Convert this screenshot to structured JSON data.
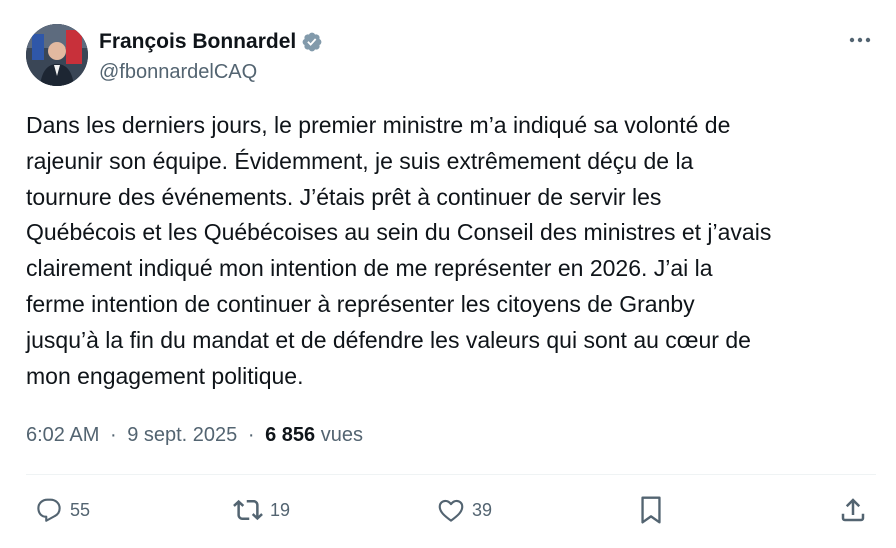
{
  "author": {
    "name": "François Bonnardel",
    "handle": "@fbonnardelCAQ",
    "verified_icon": "verified-badge-icon",
    "accent_color": "#1d9bf0"
  },
  "tweet": {
    "lines": [
      "Dans les derniers jours, le premier ministre m’a indiqué sa volonté de",
      "rajeunir son équipe. Évidemment, je suis extrêmement déçu de la",
      "tournure des événements. J’étais prêt à continuer de servir les",
      "Québécois et les Québécoises au sein du Conseil des ministres et j’avais",
      "clairement indiqué mon intention de me représenter en 2026. J’ai la",
      "ferme intention de continuer à représenter les citoyens de Granby",
      "jusqu’à la fin du mandat et de défendre les valeurs qui sont au cœur de",
      "mon engagement politique."
    ]
  },
  "meta": {
    "time": "6:02 AM",
    "date": "9 sept. 2025",
    "separator": "·",
    "views_count": "6 856",
    "views_label": "vues"
  },
  "actions": {
    "replies": "55",
    "reposts": "19",
    "likes": "39"
  },
  "colors": {
    "text": "#0f1419",
    "secondary": "#536471",
    "divider": "#eff3f4"
  }
}
